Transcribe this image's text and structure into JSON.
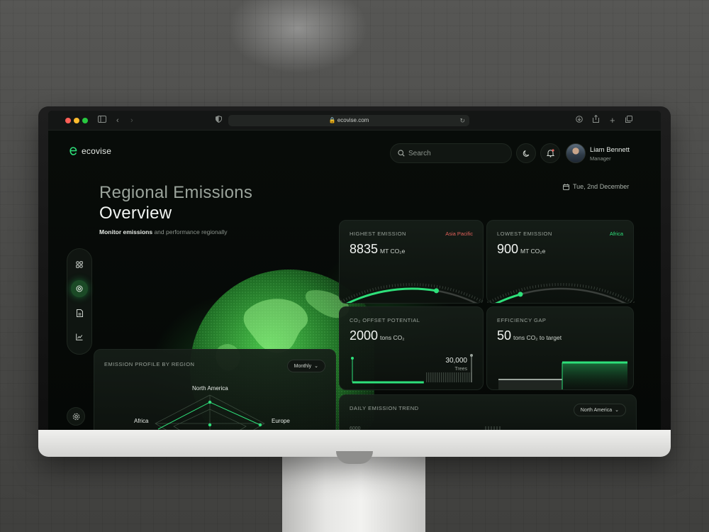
{
  "browser": {
    "url": "ecovise.com"
  },
  "app": {
    "brand": "ecovise",
    "search_placeholder": "Search",
    "user": {
      "name": "Liam Bennett",
      "role": "Manager"
    },
    "date": "Tue, 2nd December"
  },
  "header": {
    "title_line1": "Regional Emissions",
    "title_line2": "Overview",
    "subtitle_bold": "Monitor emissions",
    "subtitle_rest": " and performance regionally"
  },
  "cards": {
    "highest": {
      "label": "HIGHEST EMISSION",
      "region": "Asia Pacific",
      "value": "8835",
      "unit": "MT CO₂e",
      "gauge_fraction": 0.65
    },
    "lowest": {
      "label": "LOWEST EMISSION",
      "region": "Africa",
      "value": "900",
      "unit": "MT CO₂e",
      "gauge_fraction": 0.25
    },
    "offset": {
      "label": "CO₂ OFFSET POTENTIAL",
      "value": "2000",
      "unit": "tons CO₂",
      "trees_value": "30,000",
      "trees_label": "Trees",
      "progress_fraction": 0.6
    },
    "efficiency": {
      "label": "EFFICIENCY GAP",
      "value": "50",
      "unit": "tons CO₂ to target"
    },
    "profile": {
      "label": "EMISSION PROFILE BY REGION",
      "filter": "Monthly",
      "regions": [
        "North America",
        "Europe",
        "Africa"
      ]
    },
    "trend": {
      "label": "DAILY EMISSION TREND",
      "filter": "North America",
      "axis_tick": "6000"
    }
  },
  "colors": {
    "accent": "#2ee07a",
    "accent_dark": "#1b4a26",
    "warn": "#e0605a",
    "bg": "#050806"
  },
  "icons": {
    "sidebar": [
      "dashboard-icon",
      "target-icon",
      "document-icon",
      "chart-icon"
    ],
    "settings": "gear-icon"
  }
}
